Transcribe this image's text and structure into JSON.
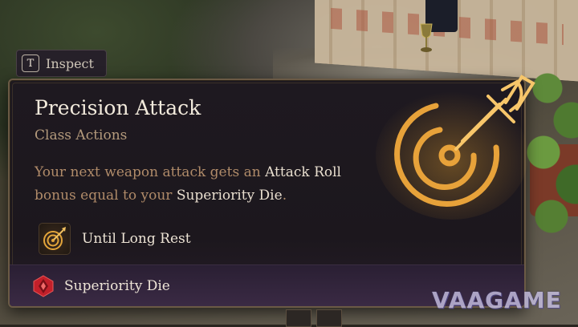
{
  "inspect_hint": {
    "key": "T",
    "label": "Inspect"
  },
  "tooltip": {
    "title": "Precision Attack",
    "subtitle": "Class Actions",
    "description": {
      "part1": "Your next weapon attack gets an ",
      "highlight1": "Attack Roll",
      "part2": " bonus equal to your ",
      "highlight2": "Superiority Die",
      "part3": "."
    },
    "duration": {
      "icon": "target-dagger-icon",
      "label": "Until Long Rest"
    },
    "resource": {
      "icon": "superiority-die-icon",
      "label": "Superiority Die"
    },
    "main_icon": "precision-attack-target-icon"
  },
  "watermark": "VAAGAME",
  "colors": {
    "title": "#f2eadc",
    "subtitle": "#b49a7c",
    "description": "#b08b69",
    "highlight": "#e9dfcf",
    "icon_glow": "#f0a830",
    "resource_band": "#3a2a44",
    "resource_icon": "#c2202a",
    "border": "#6b5a45"
  }
}
